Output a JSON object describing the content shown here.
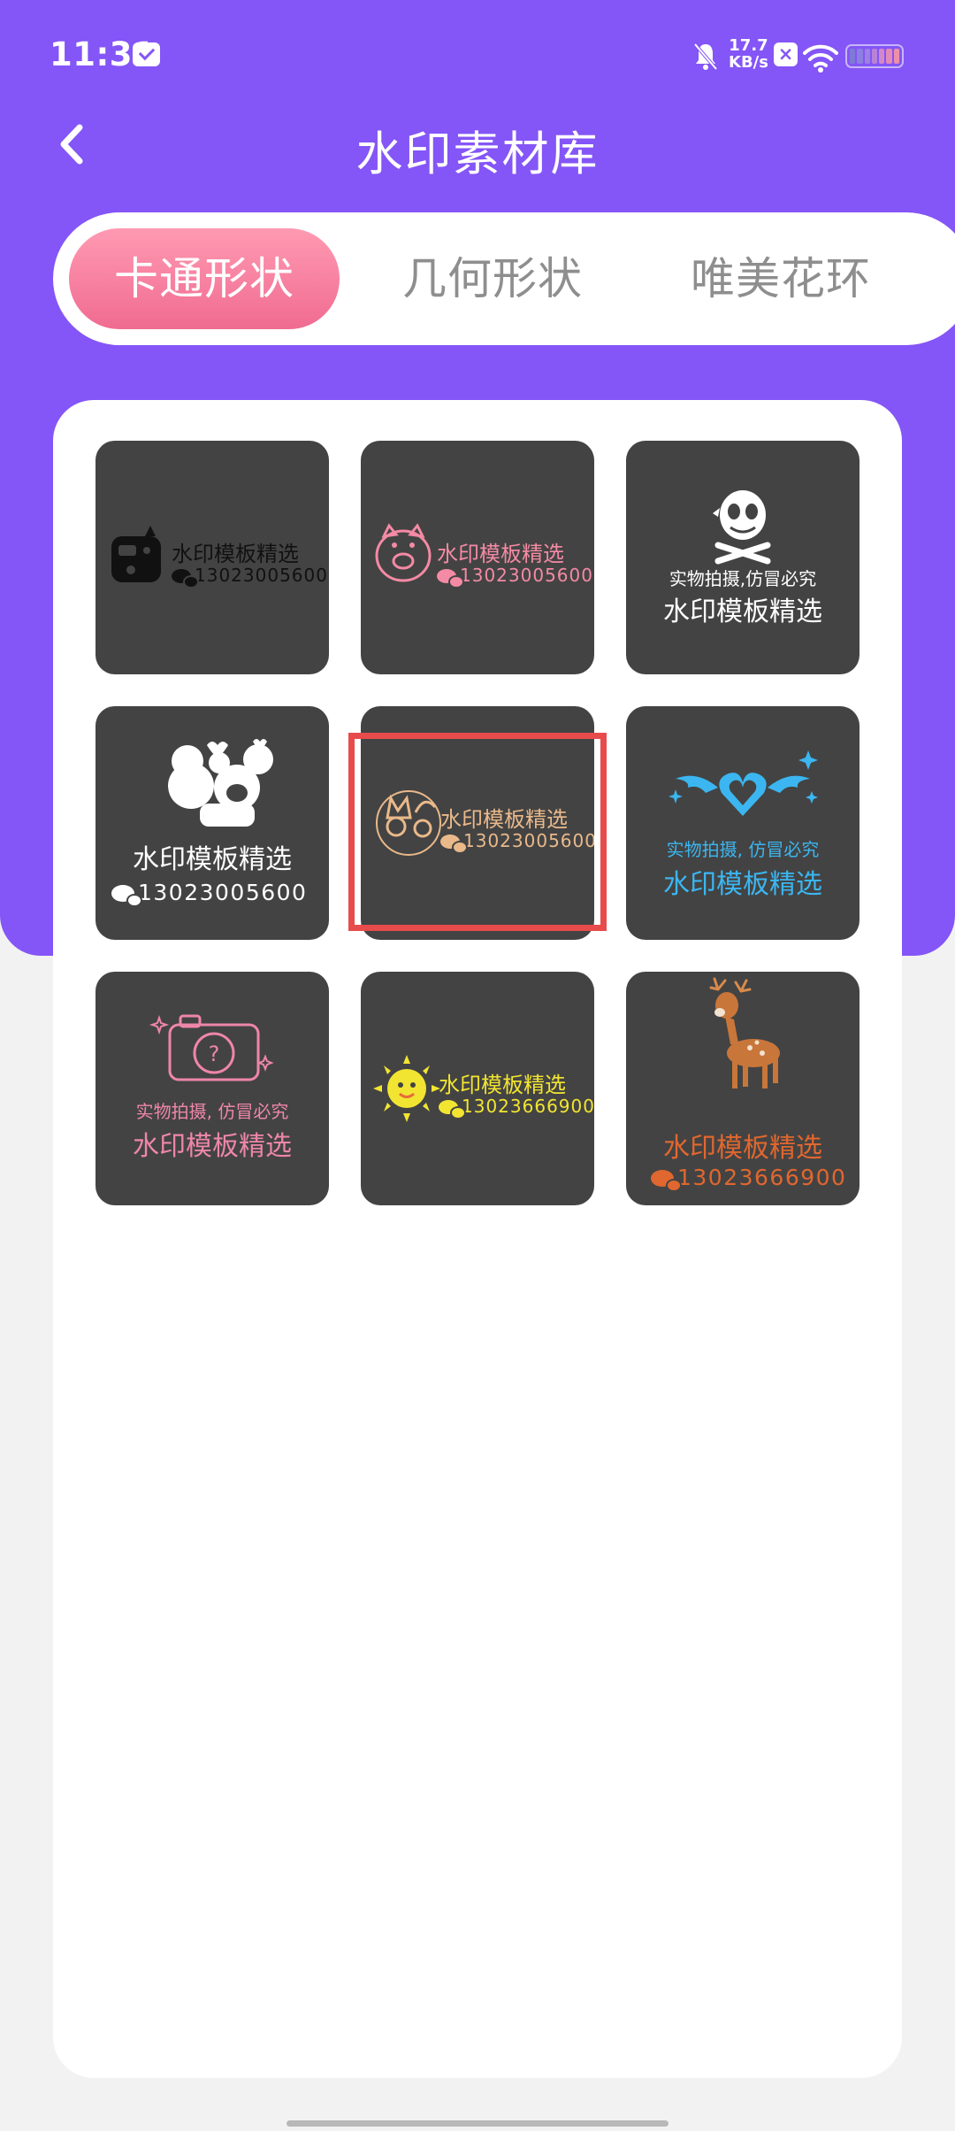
{
  "status_bar": {
    "time": "11:31",
    "net_speed_value": "17.7",
    "net_speed_unit": "KB/s",
    "battery_colors": [
      "#7e7ad6",
      "#8c7fe0",
      "#9d82df",
      "#b883d6",
      "#d388c8",
      "#e38bb8",
      "#ee8fa8"
    ]
  },
  "header": {
    "title": "水印素材库",
    "back_icon": "chevron-left-icon"
  },
  "tabs": [
    {
      "label": "卡通形状",
      "active": true
    },
    {
      "label": "几何形状",
      "active": false
    },
    {
      "label": "唯美花环",
      "active": false
    }
  ],
  "tiles": [
    {
      "icon": "game-cat-icon",
      "main": "水印模板精选",
      "phone": "13023005600",
      "color": "#111111"
    },
    {
      "icon": "pig-icon",
      "main": "水印模板精选",
      "phone": "13023005600",
      "color": "#f48aa4"
    },
    {
      "icon": "skull-icon",
      "sub": "实物拍摄,仿冒必究",
      "main": "水印模板精选",
      "color": "#ffffff"
    },
    {
      "icon": "mickey-minnie-icon",
      "main": "水印模板精选",
      "phone": "13023005600",
      "color": "#ffffff"
    },
    {
      "icon": "cats-icon",
      "main": "水印模板精选",
      "phone": "13023005600",
      "color": "#e9b98a"
    },
    {
      "icon": "winged-heart-icon",
      "sub": "实物拍摄, 仿冒必究",
      "main": "水印模板精选",
      "color": "#3bb6f0"
    },
    {
      "icon": "camera-icon",
      "sub": "实物拍摄, 仿冒必究",
      "main": "水印模板精选",
      "color": "#ee86aa"
    },
    {
      "icon": "sun-icon",
      "main": "水印模板精选",
      "phone": "13023666900",
      "color": "#f2e531"
    },
    {
      "icon": "deer-icon",
      "main": "水印模板精选",
      "phone": "13023666900",
      "color": "#e0672f"
    }
  ],
  "selected_tile_index": 4,
  "colors": {
    "header_bg": "#8455f7",
    "tab_active_gradient_top": "#ff9ab2",
    "tab_active_gradient_bottom": "#f06b91",
    "tile_bg": "#434343",
    "selection_border": "#e84b4b"
  }
}
